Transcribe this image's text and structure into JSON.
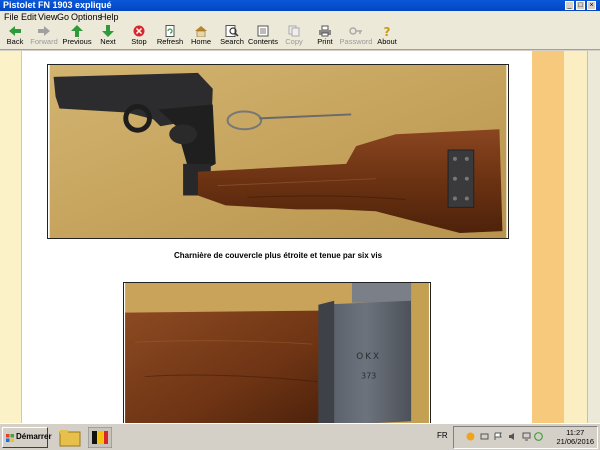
{
  "window": {
    "title": "Pistolet FN 1903 expliqué"
  },
  "menu": [
    "File",
    "Edit",
    "View",
    "Go",
    "Options",
    "Help"
  ],
  "toolbar": [
    {
      "label": "Back",
      "icon": "back-arrow-icon",
      "enabled": true
    },
    {
      "label": "Forward",
      "icon": "forward-arrow-icon",
      "enabled": false
    },
    {
      "label": "Previous",
      "icon": "up-arrow-icon",
      "enabled": true
    },
    {
      "label": "Next",
      "icon": "down-arrow-icon",
      "enabled": true
    },
    {
      "label": "Stop",
      "icon": "stop-icon",
      "enabled": true
    },
    {
      "label": "Refresh",
      "icon": "refresh-icon",
      "enabled": true
    },
    {
      "label": "Home",
      "icon": "home-icon",
      "enabled": true
    },
    {
      "label": "Search",
      "icon": "search-icon",
      "enabled": true
    },
    {
      "label": "Contents",
      "icon": "contents-icon",
      "enabled": true
    },
    {
      "label": "Copy",
      "icon": "copy-icon",
      "enabled": false
    },
    {
      "label": "Print",
      "icon": "print-icon",
      "enabled": true
    },
    {
      "label": "Password",
      "icon": "key-icon",
      "enabled": false
    },
    {
      "label": "About",
      "icon": "about-icon",
      "enabled": true
    }
  ],
  "page": {
    "caption": "Charnière de couvercle plus étroite et tenue par six vis",
    "stamp_letters": "OKX",
    "stamp_number": "373"
  },
  "taskbar": {
    "start_label": "Démarrer",
    "language": "FR",
    "time": "11:27",
    "date": "21/06/2016"
  },
  "colors": {
    "titlebar": "#0a58d8",
    "margin_left": "#fbf2c8",
    "margin_right_dark": "#f7c97d",
    "margin_right_light": "#fbeec3"
  }
}
